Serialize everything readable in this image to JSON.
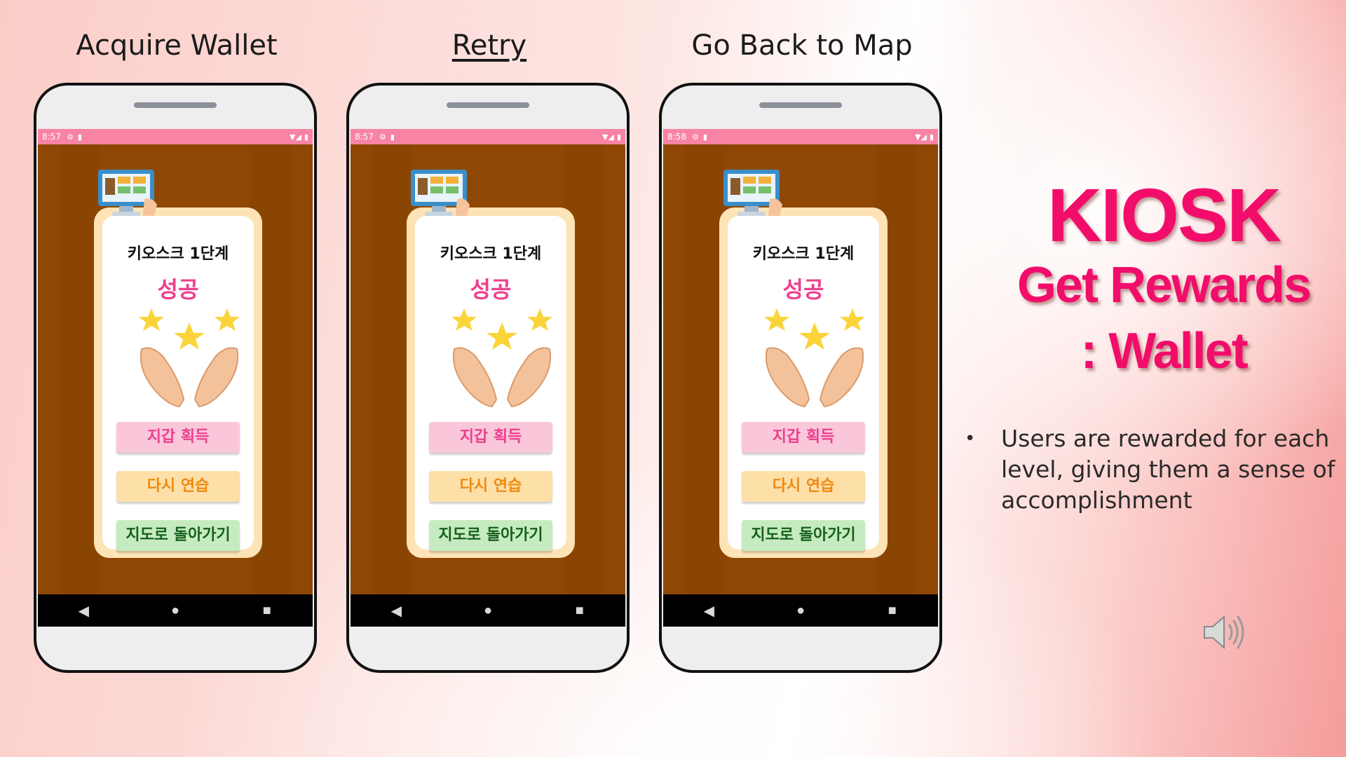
{
  "captions": [
    "Acquire Wallet",
    "Retry",
    "Go Back to Map"
  ],
  "phones": [
    {
      "time": "8:57"
    },
    {
      "time": "8:57"
    },
    {
      "time": "8:58"
    }
  ],
  "app": {
    "level_title": "키오스크 1단계",
    "success_text": "성공",
    "buttons": {
      "wallet": "지갑 획득",
      "retry": "다시 연습",
      "map": "지도로 돌아가기"
    },
    "nav": {
      "back": "◀",
      "home": "●",
      "recents": "■"
    },
    "status_icons": {
      "settings": "⚙",
      "storage": "▮",
      "wifi": "▼◢",
      "battery": "▮"
    }
  },
  "slide": {
    "title_line1": "KIOSK",
    "title_line2": "Get Rewards",
    "title_line3": ": Wallet",
    "bullet_symbol": "•",
    "bullet_text": "Users are rewarded for each level, giving them a sense of accomplishment"
  },
  "colors": {
    "accent_pink": "#f20d6a",
    "status_bar": "#f883a3",
    "app_background": "#8f4704",
    "success_pink": "#ee3f8f"
  },
  "icons": [
    "kiosk-screen-icon",
    "reward-hands-stars-icon",
    "speaker-volume-icon"
  ]
}
